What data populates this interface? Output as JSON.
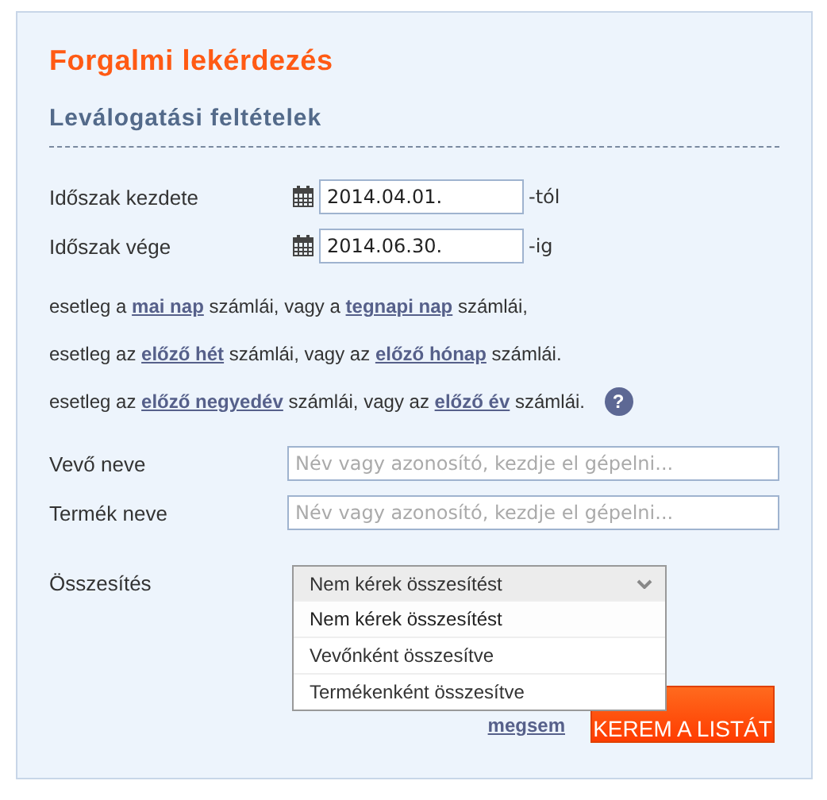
{
  "title": "Forgalmi lekérdezés",
  "subtitle": "Leválogatási feltételek",
  "date_fields": [
    {
      "label": "Időszak kezdete",
      "value": "2014.04.01.",
      "suffix": "-tól"
    },
    {
      "label": "Időszak vége",
      "value": "2014.06.30.",
      "suffix": "-ig"
    }
  ],
  "shortcuts": [
    [
      {
        "kind": "text",
        "text": "esetleg a "
      },
      {
        "kind": "link",
        "text": "mai nap"
      },
      {
        "kind": "text",
        "text": " számlái, vagy a "
      },
      {
        "kind": "link",
        "text": "tegnapi nap"
      },
      {
        "kind": "text",
        "text": " számlái,"
      }
    ],
    [
      {
        "kind": "text",
        "text": "esetleg az "
      },
      {
        "kind": "link",
        "text": "előző hét"
      },
      {
        "kind": "text",
        "text": " számlái, vagy az "
      },
      {
        "kind": "link",
        "text": "előző hónap"
      },
      {
        "kind": "text",
        "text": " számlái."
      }
    ],
    [
      {
        "kind": "text",
        "text": "esetleg az "
      },
      {
        "kind": "link",
        "text": "előző negyedév"
      },
      {
        "kind": "text",
        "text": " számlái, vagy az "
      },
      {
        "kind": "link",
        "text": "előző év"
      },
      {
        "kind": "text",
        "text": " számlái."
      }
    ]
  ],
  "help": "?",
  "name_fields": [
    {
      "label": "Vevő neve",
      "placeholder": "Név vagy azonosító, kezdje el gépelni..."
    },
    {
      "label": "Termék neve",
      "placeholder": "Név vagy azonosító, kezdje el gépelni..."
    }
  ],
  "summary": {
    "label": "Összesítés",
    "value": "Nem kérek összesítést",
    "expanded": true,
    "options": [
      {
        "label": "Nem kérek összesítést",
        "selected": true
      },
      {
        "label": "Vevőnként összesítve",
        "selected": false
      },
      {
        "label": "Termékenként összesítve",
        "selected": false
      }
    ]
  },
  "cancel_link": "megsem",
  "submit_button": "KEREM A LISTÁT"
}
